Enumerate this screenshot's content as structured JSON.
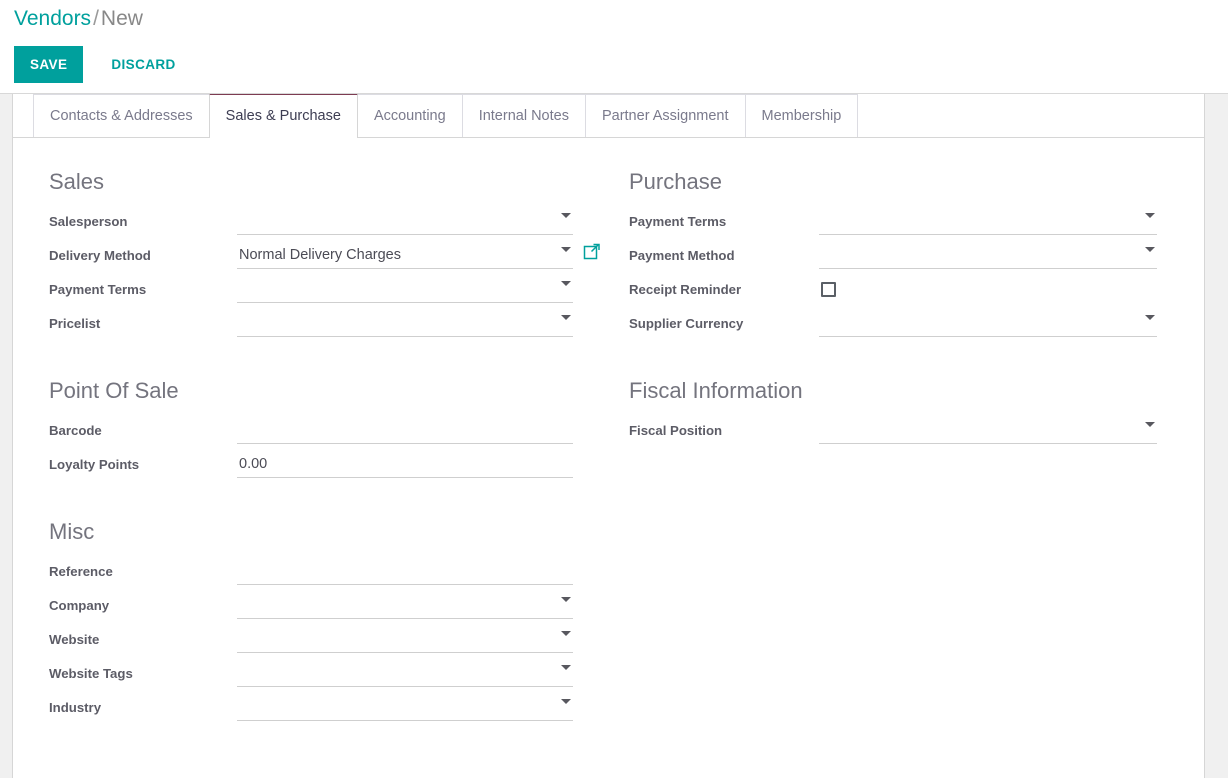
{
  "breadcrumb": {
    "root": "Vendors",
    "separator": "/",
    "current": "New"
  },
  "actions": {
    "save_label": "SAVE",
    "discard_label": "DISCARD"
  },
  "colors": {
    "accent": "#00a09d",
    "active_tab_border": "#7d3c52",
    "label": "#5c5c66",
    "heading": "#74747e"
  },
  "tabs": [
    {
      "label": "Contacts & Addresses",
      "active": false
    },
    {
      "label": "Sales & Purchase",
      "active": true
    },
    {
      "label": "Accounting",
      "active": false
    },
    {
      "label": "Internal Notes",
      "active": false
    },
    {
      "label": "Partner Assignment",
      "active": false
    },
    {
      "label": "Membership",
      "active": false
    }
  ],
  "groups": {
    "sales": {
      "title": "Sales",
      "fields": {
        "salesperson": {
          "label": "Salesperson",
          "value": "",
          "placeholder": ""
        },
        "delivery_method": {
          "label": "Delivery Method",
          "value": "Normal Delivery Charges",
          "placeholder": "",
          "link_icon": "external-link-icon"
        },
        "payment_terms": {
          "label": "Payment Terms",
          "value": "",
          "placeholder": ""
        },
        "pricelist": {
          "label": "Pricelist",
          "value": "",
          "placeholder": ""
        }
      }
    },
    "purchase": {
      "title": "Purchase",
      "fields": {
        "payment_terms": {
          "label": "Payment Terms",
          "value": "",
          "placeholder": ""
        },
        "payment_method": {
          "label": "Payment Method",
          "value": "",
          "placeholder": ""
        },
        "receipt_reminder": {
          "label": "Receipt Reminder",
          "checked": false
        },
        "supplier_currency": {
          "label": "Supplier Currency",
          "value": "",
          "placeholder": ""
        }
      }
    },
    "point_of_sale": {
      "title": "Point Of Sale",
      "fields": {
        "barcode": {
          "label": "Barcode",
          "value": "",
          "placeholder": ""
        },
        "loyalty_points": {
          "label": "Loyalty Points",
          "value": "0.00",
          "placeholder": ""
        }
      }
    },
    "fiscal_information": {
      "title": "Fiscal Information",
      "fields": {
        "fiscal_position": {
          "label": "Fiscal Position",
          "value": "",
          "placeholder": ""
        }
      }
    },
    "misc": {
      "title": "Misc",
      "fields": {
        "reference": {
          "label": "Reference",
          "value": "",
          "placeholder": ""
        },
        "company": {
          "label": "Company",
          "value": "",
          "placeholder": ""
        },
        "website": {
          "label": "Website",
          "value": "",
          "placeholder": ""
        },
        "website_tags": {
          "label": "Website Tags",
          "value": "",
          "placeholder": ""
        },
        "industry": {
          "label": "Industry",
          "value": "",
          "placeholder": ""
        }
      }
    }
  }
}
